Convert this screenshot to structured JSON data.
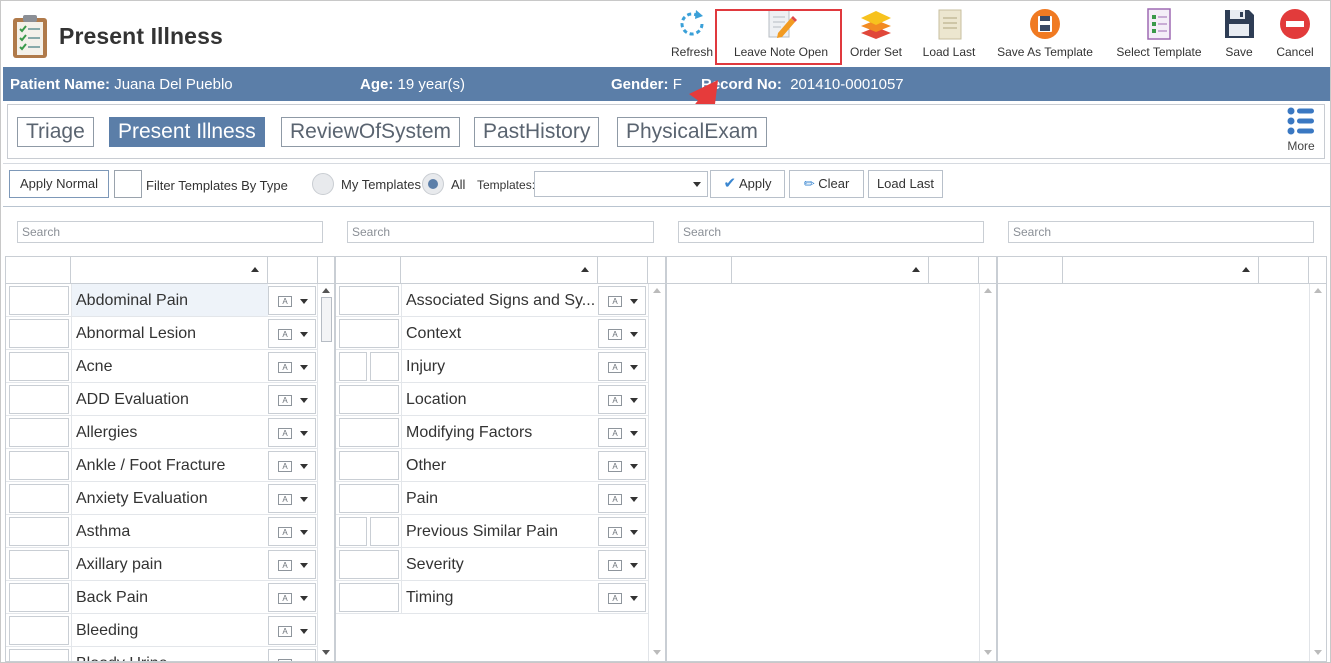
{
  "header": {
    "title": "Present Illness",
    "logo_icon": "clipboard-checklist-icon"
  },
  "toolbar": [
    {
      "key": "refresh",
      "label": "Refresh",
      "icon": "refresh-icon"
    },
    {
      "key": "leave_note_open",
      "label": "Leave Note Open",
      "icon": "edit-note-icon"
    },
    {
      "key": "order_set",
      "label": "Order Set",
      "icon": "layers-icon"
    },
    {
      "key": "load_last",
      "label": "Load Last",
      "icon": "document-icon"
    },
    {
      "key": "save_as_template",
      "label": "Save As Template",
      "icon": "floppy-circle-icon"
    },
    {
      "key": "select_template",
      "label": "Select Template",
      "icon": "checklist-icon"
    },
    {
      "key": "save",
      "label": "Save",
      "icon": "save-icon"
    },
    {
      "key": "cancel",
      "label": "Cancel",
      "icon": "cancel-icon"
    }
  ],
  "highlight_color": "#e0393e",
  "patient": {
    "name_label": "Patient Name:",
    "name": "Juana Del Pueblo",
    "age_label": "Age:",
    "age": "19 year(s)",
    "gender_label": "Gender:",
    "gender": "F",
    "record_label": "Record No:",
    "record": "201410-0001057"
  },
  "tabs": [
    "Triage",
    "Present Illness",
    "ReviewOfSystem",
    "PastHistory",
    "PhysicalExam"
  ],
  "active_tab": "Present Illness",
  "more_label": "More",
  "filters": {
    "apply_normal": "Apply Normal",
    "filter_by_type": "Filter Templates By Type",
    "my_templates": "My Templates",
    "all": "All",
    "selected_radio": "All",
    "templates_label": "Templates:",
    "templates_value": "",
    "apply": "Apply",
    "clear": "Clear",
    "load_last": "Load Last"
  },
  "search_placeholder": "Search",
  "grid1": [
    "Abdominal Pain",
    "Abnormal Lesion",
    "Acne",
    "ADD Evaluation",
    "Allergies",
    "Ankle / Foot Fracture",
    "Anxiety Evaluation",
    "Asthma",
    "Axillary pain",
    "Back Pain",
    "Bleeding",
    "Bloody Urine"
  ],
  "grid2": [
    "Associated Signs and Sy...",
    "Context",
    "Injury",
    "Location",
    "Modifying Factors",
    "Other",
    "Pain",
    "Previous Similar Pain",
    "Severity",
    "Timing"
  ],
  "colors": {
    "accent": "#5b7ea8",
    "bar": "#5b7ea8"
  }
}
